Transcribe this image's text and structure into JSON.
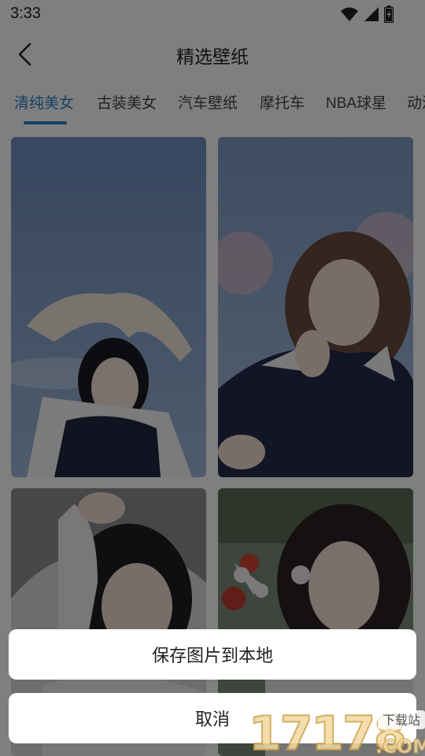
{
  "status_bar": {
    "time": "3:33"
  },
  "header": {
    "title": "精选壁纸"
  },
  "tabs": [
    {
      "label": "清纯美女",
      "active": true
    },
    {
      "label": "古装美女",
      "active": false
    },
    {
      "label": "汽车壁纸",
      "active": false
    },
    {
      "label": "摩托车",
      "active": false
    },
    {
      "label": "NBA球星",
      "active": false
    },
    {
      "label": "动漫",
      "active": false
    }
  ],
  "gallery": {
    "items": [
      {
        "description": "wallpaper-photo"
      },
      {
        "description": "wallpaper-photo"
      },
      {
        "description": "wallpaper-photo"
      },
      {
        "description": "wallpaper-photo"
      }
    ]
  },
  "action_sheet": {
    "save_label": "保存图片到本地",
    "cancel_label": "取消"
  },
  "watermark": {
    "number": "17178",
    "tag": "下载站",
    "domain": ".COM"
  },
  "colors": {
    "accent": "#2a83c8",
    "overlay": "rgba(0,0,0,0.5)"
  }
}
